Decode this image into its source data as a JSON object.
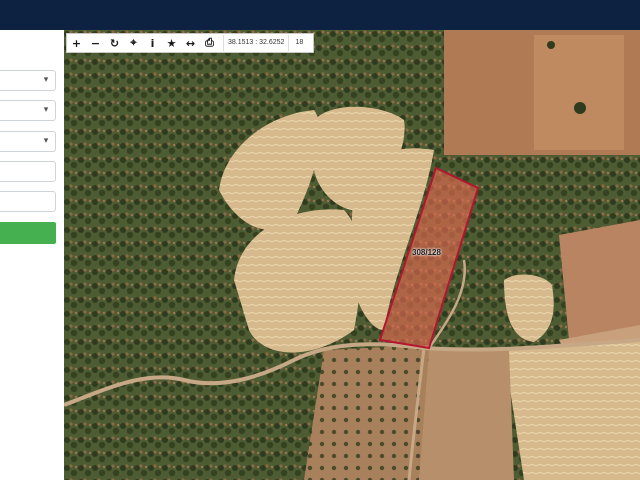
{
  "header": {},
  "toolbar": {
    "buttons": [
      {
        "icon": "zoom-in-icon",
        "glyph": "+"
      },
      {
        "icon": "zoom-out-icon",
        "glyph": "−"
      },
      {
        "icon": "refresh-icon",
        "glyph": "↻"
      },
      {
        "icon": "locate-icon",
        "glyph": "⌖"
      },
      {
        "icon": "info-icon",
        "glyph": "i"
      },
      {
        "icon": "favorite-icon",
        "glyph": "★"
      },
      {
        "icon": "measure-icon",
        "glyph": "↔"
      },
      {
        "icon": "print-icon",
        "glyph": "⎙"
      }
    ],
    "coordinates": "38.1513 : 32.6252",
    "zoom_level": "18"
  },
  "map": {
    "parcel_label": "308/128",
    "parcel_color": "#b3162f"
  },
  "colors": {
    "header_bg": "#0d2240",
    "search_button": "#45b04f"
  }
}
